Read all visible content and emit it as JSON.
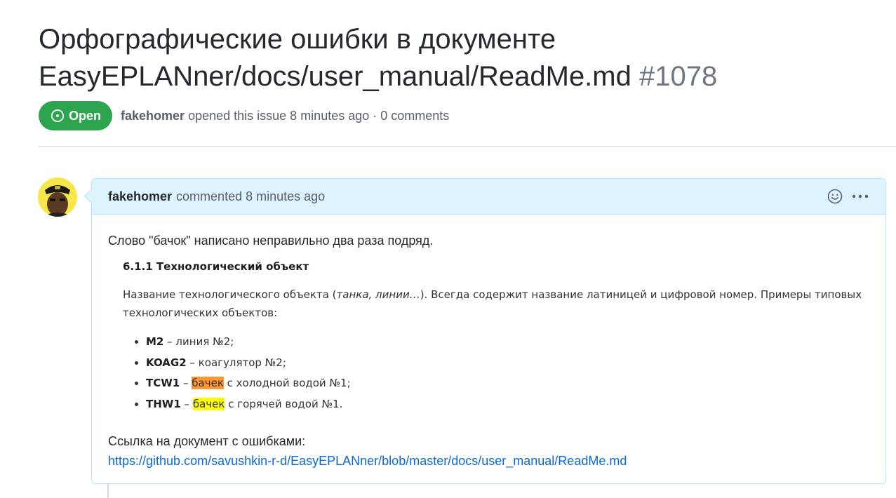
{
  "issue": {
    "title": "Орфографические ошибки в документе EasyEPLANner/docs/user_manual/ReadMe.md",
    "number": "#1078",
    "state": "Open",
    "author": "fakehomer",
    "opened_text": "opened this issue 8 minutes ago · 0 comments"
  },
  "comment": {
    "author": "fakehomer",
    "action_text": "commented 8 minutes ago",
    "body_text": "Слово \"бачок\" написано неправильно два раза подряд.",
    "embed": {
      "heading": "6.1.1 Технологический объект",
      "para_before_italic": "Название технологического объекта (",
      "para_italic": "танка, линии…",
      "para_after_italic": "). Всегда содержит название латиницей и цифровой номер. Примеры типовых технологических объектов:",
      "items": [
        {
          "code": "M2",
          "dash": " – ",
          "highlight": "",
          "text": "линия №2;"
        },
        {
          "code": "KOAG2",
          "dash": " – ",
          "highlight": "",
          "text": "коагулятор №2;"
        },
        {
          "code": "TCW1",
          "dash": " – ",
          "highlight": "бачек",
          "text": " с холодной водой №1;"
        },
        {
          "code": "THW1",
          "dash": " – ",
          "highlight": "бачек",
          "text": " с горячей водой №1."
        }
      ]
    },
    "link_label": "Ссылка на документ с ошибками:",
    "link_url": "https://github.com/savushkin-r-d/EasyEPLANner/blob/master/docs/user_manual/ReadMe.md"
  },
  "icons": {
    "state": "issue-opened-icon",
    "reaction": "smiley-icon",
    "more": "kebab-horizontal-icon"
  },
  "colors": {
    "open_badge": "#2da44e",
    "header_bg": "#ddf4ff",
    "link": "#0969da",
    "highlight_orange": "#ff9632",
    "highlight_yellow": "#ffff00"
  }
}
